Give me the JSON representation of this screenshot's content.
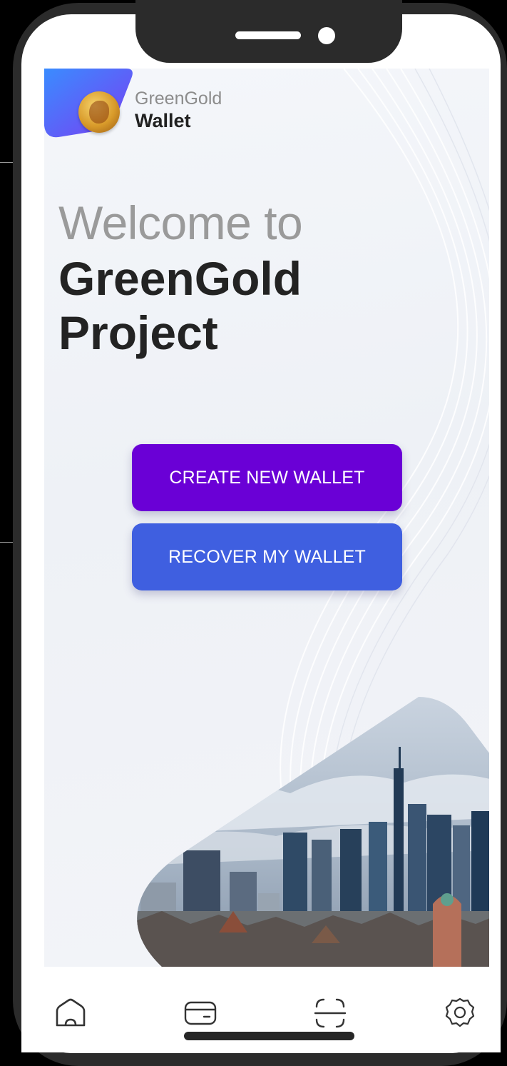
{
  "app": {
    "brand_top": "GreenGold",
    "brand_bottom": "Wallet"
  },
  "hero": {
    "welcome": "Welcome to",
    "title": "GreenGold Project"
  },
  "actions": {
    "create": "CREATE NEW WALLET",
    "recover": "RECOVER MY WALLET"
  },
  "colors": {
    "create_button": "#6a00d6",
    "recover_button": "#3f5fe0",
    "logo_blob": "#6a4cf0"
  },
  "tab_bar": {
    "items": [
      {
        "icon": "home-icon"
      },
      {
        "icon": "card-icon"
      },
      {
        "icon": "scan-icon"
      },
      {
        "icon": "settings-icon"
      }
    ]
  }
}
